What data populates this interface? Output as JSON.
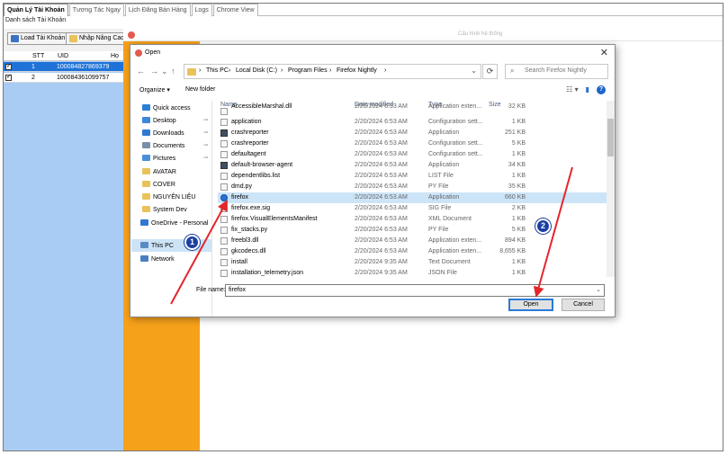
{
  "app": {
    "tabs": [
      "Quản Lý Tài Khoản",
      "Tương Tác Ngay",
      "Lịch Đăng Bán Hàng",
      "Logs",
      "Chrome View"
    ],
    "subtitle": "Danh sách Tài Khoản",
    "load_button": "Load Tài Khoản",
    "import_button": "Nhập Nâng Cao",
    "grid_headers": [
      "STT",
      "UID",
      "Ho T"
    ],
    "accounts": [
      {
        "stt": "1",
        "uid": "100084827869379",
        "checked": true,
        "selected": true
      },
      {
        "stt": "2",
        "uid": "100084361099757",
        "checked": true,
        "selected": false
      }
    ],
    "background_window_title": "Cấu hình hệ thống"
  },
  "dialog": {
    "title": "Open",
    "close_glyph": "✕",
    "nav": {
      "back": "←",
      "forward": "→",
      "up": "↑",
      "recent": "⌄",
      "refresh": "⟳"
    },
    "breadcrumb": [
      "This PC",
      "Local Disk (C:)",
      "Program Files",
      "Firefox Nightly"
    ],
    "breadcrumb_sep": "›",
    "search_placeholder": "Search Firefox Nightly",
    "organize": "Organize ▾",
    "new_folder": "New folder",
    "view_menu": "☷ ▾",
    "pane_toggle": "▮",
    "help": "?",
    "nav_pane": [
      {
        "label": "Quick access",
        "icon": "star-icon",
        "color": "#2d7fd5",
        "pinned": false
      },
      {
        "label": "Desktop",
        "icon": "desktop-icon",
        "color": "#3d87d8",
        "pinned": true
      },
      {
        "label": "Downloads",
        "icon": "download-icon",
        "color": "#2f7ad0",
        "pinned": true
      },
      {
        "label": "Documents",
        "icon": "documents-icon",
        "color": "#7a8fa9",
        "pinned": true
      },
      {
        "label": "Pictures",
        "icon": "pictures-icon",
        "color": "#4a90d8",
        "pinned": true
      },
      {
        "label": "AVATAR",
        "icon": "folder-icon",
        "color": "#e9c25a",
        "pinned": false
      },
      {
        "label": "COVER",
        "icon": "folder-icon",
        "color": "#e9c25a",
        "pinned": false
      },
      {
        "label": "NGUYÊN LIỆU",
        "icon": "folder-icon",
        "color": "#e9c25a",
        "pinned": false
      },
      {
        "label": "System Dev",
        "icon": "folder-icon",
        "color": "#e9c25a",
        "pinned": false
      },
      {
        "label": "OneDrive - Personal",
        "icon": "cloud-icon",
        "color": "#2f7ad0",
        "pinned": false
      },
      {
        "label": "This PC",
        "icon": "computer-icon",
        "color": "#5b8bc3",
        "pinned": false
      },
      {
        "label": "Network",
        "icon": "network-icon",
        "color": "#4a7fbf",
        "pinned": false
      }
    ],
    "pin_glyph": "📌",
    "columns": [
      "Name",
      "Date modified",
      "Type",
      "Size"
    ],
    "files": [
      {
        "name": "AccessibleMarshal.dll",
        "date": "2/20/2024 6:53 AM",
        "type": "Application exten...",
        "size": "32 KB",
        "icon": "dll"
      },
      {
        "name": "application",
        "date": "2/20/2024 6:53 AM",
        "type": "Configuration sett...",
        "size": "1 KB",
        "icon": "file"
      },
      {
        "name": "crashreporter",
        "date": "2/20/2024 6:53 AM",
        "type": "Application",
        "size": "251 KB",
        "icon": "app"
      },
      {
        "name": "crashreporter",
        "date": "2/20/2024 6:53 AM",
        "type": "Configuration sett...",
        "size": "5 KB",
        "icon": "file"
      },
      {
        "name": "defaultagent",
        "date": "2/20/2024 6:53 AM",
        "type": "Configuration sett...",
        "size": "1 KB",
        "icon": "file"
      },
      {
        "name": "default-browser-agent",
        "date": "2/20/2024 6:53 AM",
        "type": "Application",
        "size": "34 KB",
        "icon": "app"
      },
      {
        "name": "dependentlibs.list",
        "date": "2/20/2024 6:53 AM",
        "type": "LIST File",
        "size": "1 KB",
        "icon": "file"
      },
      {
        "name": "dmd.py",
        "date": "2/20/2024 6:53 AM",
        "type": "PY File",
        "size": "35 KB",
        "icon": "file"
      },
      {
        "name": "firefox",
        "date": "2/20/2024 6:53 AM",
        "type": "Application",
        "size": "660 KB",
        "icon": "ff"
      },
      {
        "name": "firefox.exe.sig",
        "date": "2/20/2024 6:53 AM",
        "type": "SIG File",
        "size": "2 KB",
        "icon": "file"
      },
      {
        "name": "firefox.VisualElementsManifest",
        "date": "2/20/2024 6:53 AM",
        "type": "XML Document",
        "size": "1 KB",
        "icon": "file"
      },
      {
        "name": "fix_stacks.py",
        "date": "2/20/2024 6:53 AM",
        "type": "PY File",
        "size": "5 KB",
        "icon": "file"
      },
      {
        "name": "freebl3.dll",
        "date": "2/20/2024 6:53 AM",
        "type": "Application exten...",
        "size": "894 KB",
        "icon": "dll"
      },
      {
        "name": "gkcodecs.dll",
        "date": "2/20/2024 6:53 AM",
        "type": "Application exten...",
        "size": "8,655 KB",
        "icon": "dll"
      },
      {
        "name": "install",
        "date": "2/20/2024 9:35 AM",
        "type": "Text Document",
        "size": "1 KB",
        "icon": "file"
      },
      {
        "name": "installation_telemetry.json",
        "date": "2/20/2024 9:35 AM",
        "type": "JSON File",
        "size": "1 KB",
        "icon": "file"
      }
    ],
    "selected_file": "firefox",
    "filename_label": "File name:",
    "filename_value": "firefox",
    "open_button": "Open",
    "cancel_button": "Cancel"
  },
  "annotations": {
    "step1": "1",
    "step2": "2",
    "arrow_color": "#e3262b",
    "badge_color": "#1a3fa0"
  }
}
